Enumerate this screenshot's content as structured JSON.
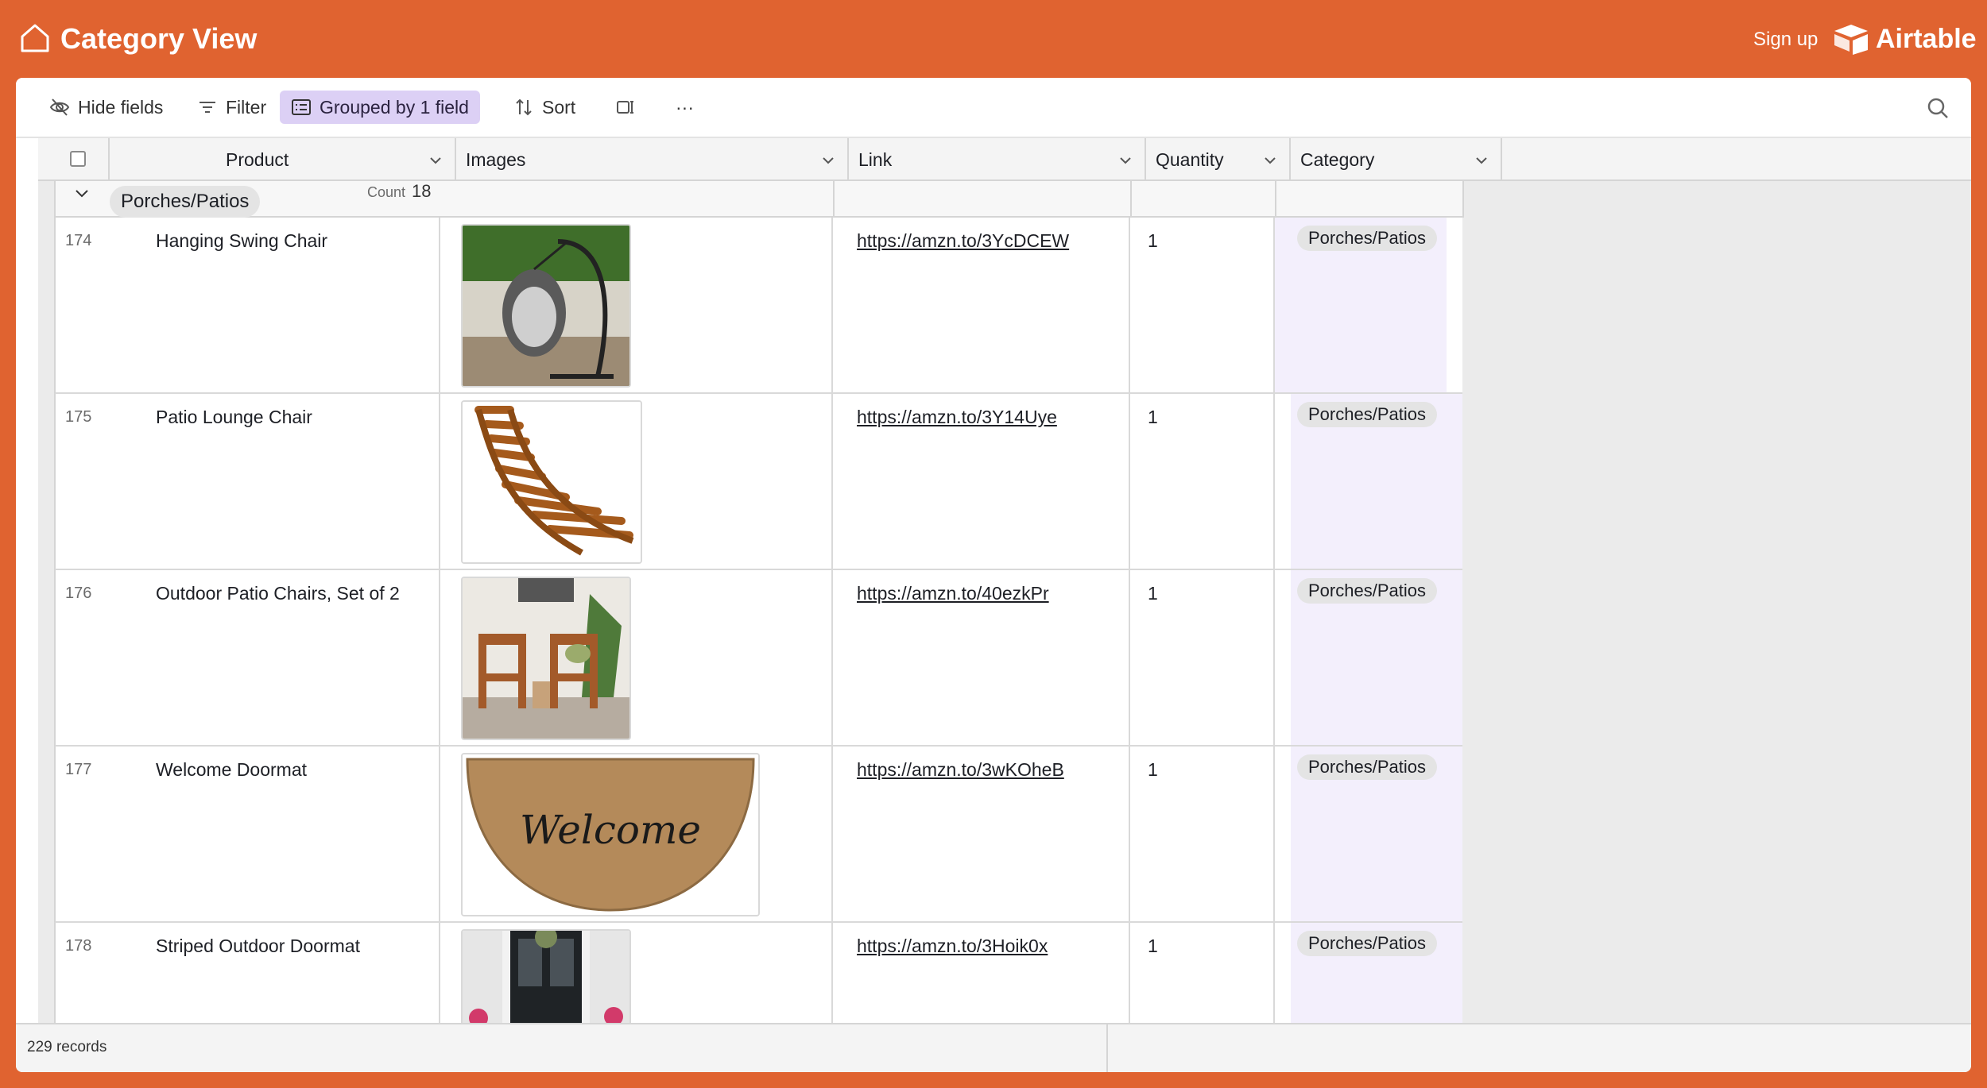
{
  "app": {
    "title": "Category View",
    "signup_label": "Sign up",
    "brand": "Airtable",
    "accent_color": "#e06330"
  },
  "toolbar": {
    "hide_fields": "Hide fields",
    "filter": "Filter",
    "grouped": "Grouped by 1 field",
    "sort": "Sort",
    "more": "···"
  },
  "columns": [
    "Product",
    "Images",
    "Link",
    "Quantity",
    "Category"
  ],
  "group": {
    "name": "Porches/Patios",
    "count_label": "Count",
    "count": "18"
  },
  "rows": [
    {
      "num": "174",
      "product": "Hanging Swing Chair",
      "link": "https://amzn.to/3YcDCEW",
      "quantity": "1",
      "category": "Porches/Patios",
      "image": "hanging-swing-chair-image"
    },
    {
      "num": "175",
      "product": "Patio Lounge Chair",
      "link": "https://amzn.to/3Y14Uye",
      "quantity": "1",
      "category": "Porches/Patios",
      "image": "patio-lounge-chair-image"
    },
    {
      "num": "176",
      "product": "Outdoor Patio Chairs, Set of 2",
      "link": "https://amzn.to/40ezkPr",
      "quantity": "1",
      "category": "Porches/Patios",
      "image": "outdoor-patio-chairs-image"
    },
    {
      "num": "177",
      "product": "Welcome Doormat",
      "link": "https://amzn.to/3wKOheB",
      "quantity": "1",
      "category": "Porches/Patios",
      "image": "welcome-doormat-image",
      "doormat_text": "Welcome"
    },
    {
      "num": "178",
      "product": "Striped Outdoor Doormat",
      "link": "https://amzn.to/3Hoik0x",
      "quantity": "1",
      "category": "Porches/Patios",
      "image": "striped-doormat-image"
    }
  ],
  "footer": {
    "records": "229 records"
  }
}
